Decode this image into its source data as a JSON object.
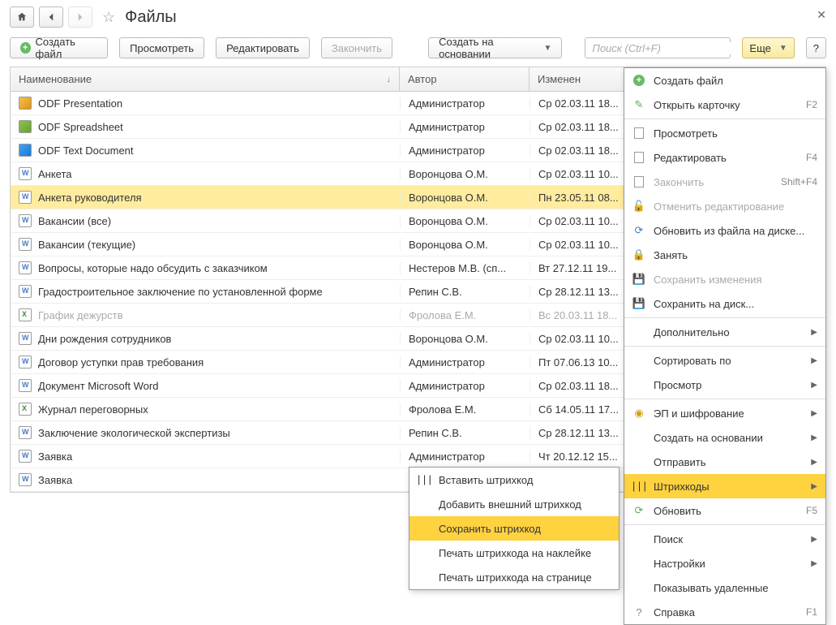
{
  "header": {
    "title": "Файлы"
  },
  "toolbar": {
    "create_file": "Создать файл",
    "view": "Просмотреть",
    "edit": "Редактировать",
    "finish": "Закончить",
    "create_based": "Создать на основании",
    "search_placeholder": "Поиск (Ctrl+F)",
    "more": "Еще",
    "help": "?"
  },
  "columns": {
    "name": "Наименование",
    "author": "Автор",
    "date": "Изменен"
  },
  "rows": [
    {
      "name": "ODF Presentation",
      "author": "Администратор",
      "date": "Ср 02.03.11 18...",
      "icon": "odf"
    },
    {
      "name": "ODF Spreadsheet",
      "author": "Администратор",
      "date": "Ср 02.03.11 18...",
      "icon": "odfg"
    },
    {
      "name": "ODF Text Document",
      "author": "Администратор",
      "date": "Ср 02.03.11 18...",
      "icon": "odft"
    },
    {
      "name": "Анкета",
      "author": "Воронцова О.М.",
      "date": "Ср 02.03.11 10...",
      "icon": "doc"
    },
    {
      "name": "Анкета руководителя",
      "author": "Воронцова О.М.",
      "date": "Пн 23.05.11 08...",
      "icon": "doc",
      "selected": true
    },
    {
      "name": "Вакансии (все)",
      "author": "Воронцова О.М.",
      "date": "Ср 02.03.11 10...",
      "icon": "doc"
    },
    {
      "name": "Вакансии (текущие)",
      "author": "Воронцова О.М.",
      "date": "Ср 02.03.11 10...",
      "icon": "doc"
    },
    {
      "name": "Вопросы, которые надо обсудить с заказчиком",
      "author": "Нестеров М.В. (сп...",
      "date": "Вт 27.12.11 19...",
      "icon": "doc"
    },
    {
      "name": "Градостроительное заключение по установленной форме",
      "author": "Репин С.В.",
      "date": "Ср 28.12.11 13...",
      "icon": "doc"
    },
    {
      "name": "График дежурств",
      "author": "Фролова Е.М.",
      "date": "Вс 20.03.11 18...",
      "icon": "xls",
      "disabled": true
    },
    {
      "name": "Дни рождения сотрудников",
      "author": "Воронцова О.М.",
      "date": "Ср 02.03.11 10...",
      "icon": "doc"
    },
    {
      "name": "Договор уступки прав требования",
      "author": "Администратор",
      "date": "Пт 07.06.13 10...",
      "icon": "doc"
    },
    {
      "name": "Документ Microsoft Word",
      "author": "Администратор",
      "date": "Ср 02.03.11 18...",
      "icon": "doc"
    },
    {
      "name": "Журнал переговорных",
      "author": "Фролова Е.М.",
      "date": "Сб 14.05.11 17...",
      "icon": "xls"
    },
    {
      "name": "Заключение экологической экспертизы",
      "author": "Репин С.В.",
      "date": "Ср 28.12.11 13...",
      "icon": "doc"
    },
    {
      "name": "Заявка",
      "author": "Администратор",
      "date": "Чт 20.12.12 15...",
      "icon": "doc"
    },
    {
      "name": "Заявка",
      "author": "",
      "date": "",
      "icon": "doc"
    }
  ],
  "menu": [
    {
      "icon": "plus",
      "label": "Создать файл"
    },
    {
      "icon": "pencil",
      "label": "Открыть карточку",
      "shortcut": "F2"
    },
    {
      "sep": true
    },
    {
      "icon": "doc",
      "label": "Просмотреть"
    },
    {
      "icon": "doc",
      "label": "Редактировать",
      "shortcut": "F4"
    },
    {
      "icon": "doc",
      "label": "Закончить",
      "shortcut": "Shift+F4",
      "disabled": true
    },
    {
      "icon": "unlock",
      "label": "Отменить редактирование",
      "disabled": true
    },
    {
      "icon": "refresh",
      "label": "Обновить из файла на диске..."
    },
    {
      "icon": "lock",
      "label": "Занять"
    },
    {
      "icon": "save",
      "label": "Сохранить изменения",
      "disabled": true
    },
    {
      "icon": "disk",
      "label": "Сохранить на диск..."
    },
    {
      "sep": true
    },
    {
      "icon": "",
      "label": "Дополнительно",
      "sub": true
    },
    {
      "sep": true
    },
    {
      "icon": "",
      "label": "Сортировать по",
      "sub": true
    },
    {
      "icon": "",
      "label": "Просмотр",
      "sub": true
    },
    {
      "sep": true
    },
    {
      "icon": "sig",
      "label": "ЭП и шифрование",
      "sub": true
    },
    {
      "icon": "",
      "label": "Создать на основании",
      "sub": true
    },
    {
      "icon": "",
      "label": "Отправить",
      "sub": true
    },
    {
      "icon": "barcode",
      "label": "Штрихкоды",
      "sub": true,
      "highlighted": true
    },
    {
      "icon": "refresh2",
      "label": "Обновить",
      "shortcut": "F5"
    },
    {
      "sep": true
    },
    {
      "icon": "",
      "label": "Поиск",
      "sub": true
    },
    {
      "icon": "",
      "label": "Настройки",
      "sub": true
    },
    {
      "icon": "",
      "label": "Показывать удаленные"
    },
    {
      "icon": "help",
      "label": "Справка",
      "shortcut": "F1"
    }
  ],
  "submenu": [
    {
      "icon": "barcode",
      "label": "Вставить штрихкод"
    },
    {
      "icon": "",
      "label": "Добавить внешний штрихкод"
    },
    {
      "icon": "",
      "label": "Сохранить штрихкод",
      "highlighted": true
    },
    {
      "icon": "",
      "label": "Печать штрихкода на наклейке"
    },
    {
      "icon": "",
      "label": "Печать штрихкода на странице"
    }
  ]
}
